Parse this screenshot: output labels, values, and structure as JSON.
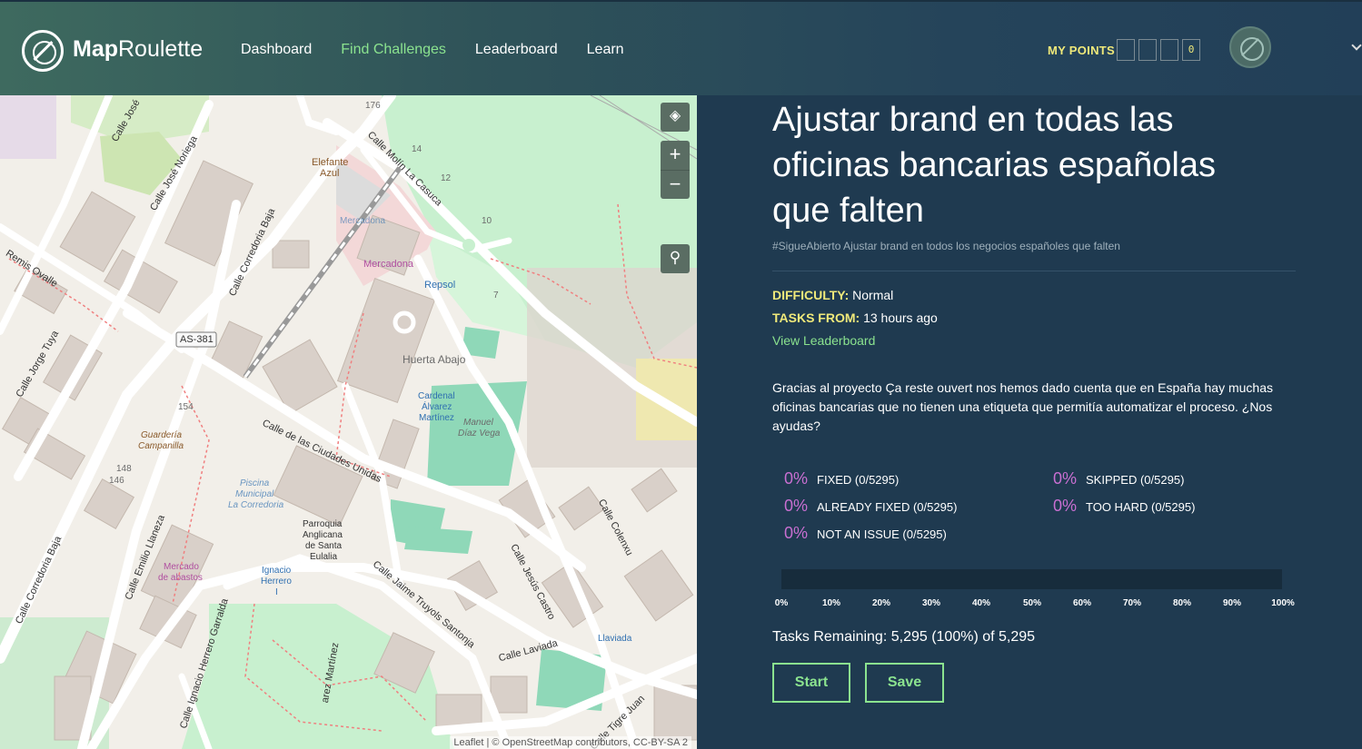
{
  "header": {
    "brand_bold": "Map",
    "brand_rest": "Roulette",
    "nav": [
      {
        "label": "Dashboard",
        "active": false
      },
      {
        "label": "Find Challenges",
        "active": true
      },
      {
        "label": "Leaderboard",
        "active": false
      },
      {
        "label": "Learn",
        "active": false
      }
    ],
    "points_label": "MY POINTS",
    "points_digits": [
      "",
      "",
      "",
      "0"
    ]
  },
  "map": {
    "layers_icon": "layers-icon",
    "zoom_in": "+",
    "zoom_out": "−",
    "attribution": "Leaflet | © OpenStreetMap contributors, CC-BY-SA 2",
    "labels": {
      "calle_jose": "Calle José",
      "calle_jose_noriega": "Calle José Noriega",
      "calle_molin": "Calle Molín La Casuca",
      "remis": "Remis Ovalle",
      "calle_corredoria_baja": "Calle Corredoria Baja",
      "calle_jorge_tuya": "Calle Jorge Tuya",
      "as381": "AS-381",
      "elefante": "Elefante",
      "azul": "Azul",
      "mercadona1": "Mercadona",
      "mercadona2": "Mercadona",
      "repsol": "Repsol",
      "huerta": "Huerta Abajo",
      "cardenal1": "Cardenal",
      "cardenal2": "Álvarez",
      "cardenal3": "Martínez",
      "manuel1": "Manuel",
      "manuel2": "Díaz Vega",
      "guarderia1": "Guardería",
      "guarderia2": "Campanilla",
      "calle_ciudades": "Calle de las Ciudades Unidas",
      "piscina1": "Piscina",
      "piscina2": "Municipal",
      "piscina3": "La Corredoria",
      "parroquia1": "Parroquia",
      "parroquia2": "Anglicana",
      "parroquia3": "de Santa",
      "parroquia4": "Eulalia",
      "calle_emilio": "Calle Emilio Llaneza",
      "calle_corredoria_baja2": "Calle Corredoria Baja",
      "mercado1": "Mercado",
      "mercado2": "de abastos",
      "ignacio1": "Ignacio",
      "ignacio2": "Herrero",
      "ignacio3": "I",
      "calle_jaime": "Calle Jaime Truyols Santonja",
      "calle_jesus": "Calle Jesús Castro",
      "calle_colenxu": "Calle Colenxu",
      "calle_laviada": "Calle Laviada",
      "llaviada": "Llaviada",
      "calle_ignacio": "Calle Ignacio Herrero Garralda",
      "calle_tigre": "Calle Tigre Juan",
      "n176": "176",
      "n14": "14",
      "n12": "12",
      "n10": "10",
      "n7": "7",
      "n154": "154",
      "n148": "148",
      "n146": "146",
      "martinez": "arez Martínez"
    }
  },
  "challenge": {
    "title": "Ajustar brand en todas las oficinas bancarias españolas que falten",
    "subtitle": "#SigueAbierto Ajustar brand en todos los negocios españoles que falten",
    "difficulty_label": "DIFFICULTY:",
    "difficulty_value": "Normal",
    "tasks_from_label": "TASKS FROM:",
    "tasks_from_value": "13 hours ago",
    "leaderboard_link": "View Leaderboard",
    "description": "Gracias al proyecto Ça reste ouvert nos hemos dado cuenta que en España hay muchas oficinas bancarias que no tienen una etiqueta que permitía automatizar el proceso. ¿Nos ayudas?",
    "stats": [
      {
        "pct": "0%",
        "label": "FIXED (0/5295)",
        "value": 0
      },
      {
        "pct": "0%",
        "label": "SKIPPED (0/5295)",
        "value": 0
      },
      {
        "pct": "0%",
        "label": "ALREADY FIXED (0/5295)",
        "value": 0
      },
      {
        "pct": "0%",
        "label": "TOO HARD (0/5295)",
        "value": 0
      },
      {
        "pct": "0%",
        "label": "NOT AN ISSUE (0/5295)",
        "value": 0
      }
    ],
    "progress_fraction": 0,
    "progress_ticks": [
      "0%",
      "10%",
      "20%",
      "30%",
      "40%",
      "50%",
      "60%",
      "70%",
      "80%",
      "90%",
      "100%"
    ],
    "remaining": "Tasks Remaining: 5,295 (100%) of 5,295",
    "start_label": "Start",
    "save_label": "Save"
  },
  "colors": {
    "accent": "#8be38f",
    "highlight": "#f0e97a",
    "stat_pct": "#c86fd1",
    "panel_bg": "#1f3a50"
  }
}
